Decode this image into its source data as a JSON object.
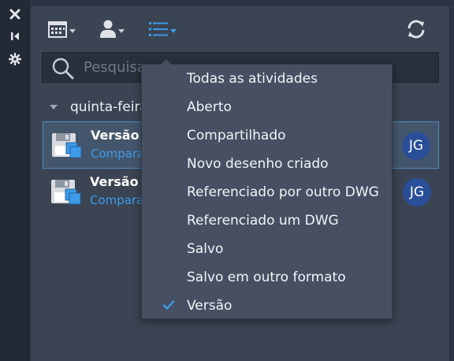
{
  "strip": {
    "close_icon": "close-icon",
    "collapse_icon": "collapse-icon",
    "settings_icon": "settings-icon"
  },
  "toolbar": {
    "calendar_icon": "calendar-icon",
    "user_icon": "user-icon",
    "list_filter_icon": "list-filter-icon",
    "refresh_icon": "refresh-icon"
  },
  "search": {
    "placeholder": "Pesquisar",
    "value": ""
  },
  "group": {
    "label": "quinta-feira"
  },
  "rows": [
    {
      "title": "Versão V",
      "link": "Compara",
      "avatar": "JG",
      "selected": true
    },
    {
      "title": "Versão V",
      "link": "Compara",
      "avatar": "JG",
      "selected": false
    }
  ],
  "menu": {
    "items": [
      {
        "label": "Todas as atividades",
        "checked": false
      },
      {
        "label": "Aberto",
        "checked": false
      },
      {
        "label": "Compartilhado",
        "checked": false
      },
      {
        "label": "Novo desenho criado",
        "checked": false
      },
      {
        "label": "Referenciado por outro DWG",
        "checked": false
      },
      {
        "label": "Referenciado um DWG",
        "checked": false
      },
      {
        "label": "Salvo",
        "checked": false
      },
      {
        "label": "Salvo em outro formato",
        "checked": false
      },
      {
        "label": "Versão",
        "checked": true
      }
    ]
  },
  "colors": {
    "accent": "#3d9be9",
    "avatar_bg": "#2a4f98",
    "panel_bg": "#3b4453",
    "menu_bg": "#465062"
  }
}
